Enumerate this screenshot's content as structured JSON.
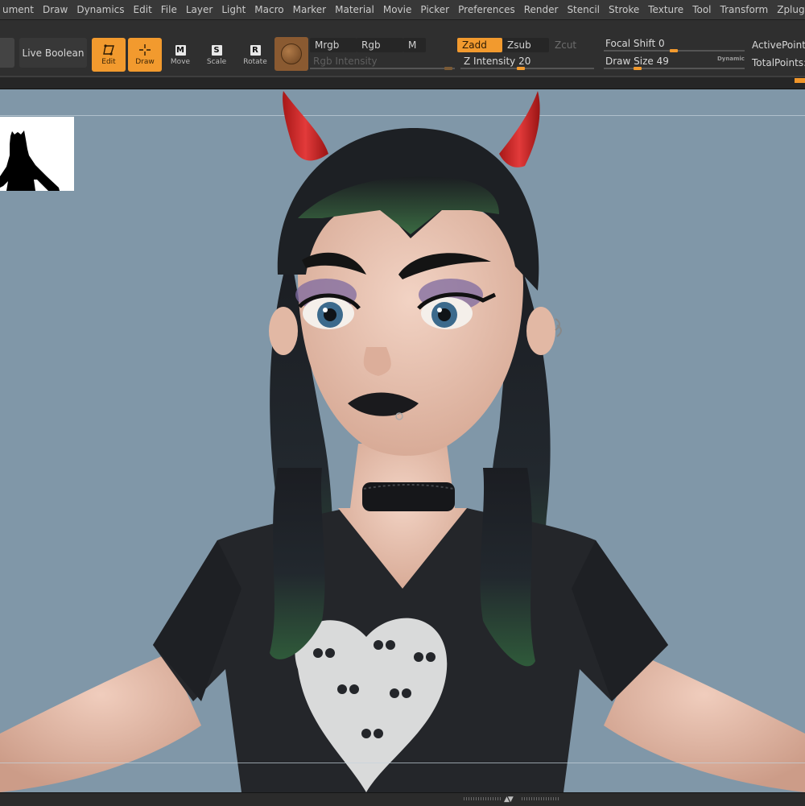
{
  "menu": [
    "ument",
    "Draw",
    "Dynamics",
    "Edit",
    "File",
    "Layer",
    "Light",
    "Macro",
    "Marker",
    "Material",
    "Movie",
    "Picker",
    "Preferences",
    "Render",
    "Stencil",
    "Stroke",
    "Texture",
    "Tool",
    "Transform",
    "Zplugi"
  ],
  "shelf": {
    "live_boolean": "Live Boolean",
    "tools": {
      "edit": "Edit",
      "draw": "Draw",
      "move": "Move",
      "scale": "Scale",
      "rotate": "Rotate"
    },
    "tool_letters": {
      "move": "M",
      "scale": "S",
      "rotate": "R"
    },
    "color": {
      "mrgb": "Mrgb",
      "rgb": "Rgb",
      "m": "M",
      "rgb_intensity": "Rgb Intensity"
    },
    "depth": {
      "zadd": "Zadd",
      "zsub": "Zsub",
      "zcut": "Zcut",
      "z_intensity": "Z Intensity 20"
    },
    "brush": {
      "focal_shift": "Focal Shift 0",
      "draw_size": "Draw Size 49",
      "dynamic": "Dynamic"
    },
    "stats": {
      "active_points": "ActivePoints:",
      "total_points": "TotalPoints: ."
    }
  },
  "tshirt_print": "skull-heart",
  "colors": {
    "accent": "#f29a2e",
    "canvas_bg": "#8097a8",
    "ui_bg": "#2f2f2f",
    "skin": "#e9c5b4",
    "hair": "#1c1f24",
    "hair_green": "#2f5a3a",
    "horns": "#d12a2a"
  }
}
